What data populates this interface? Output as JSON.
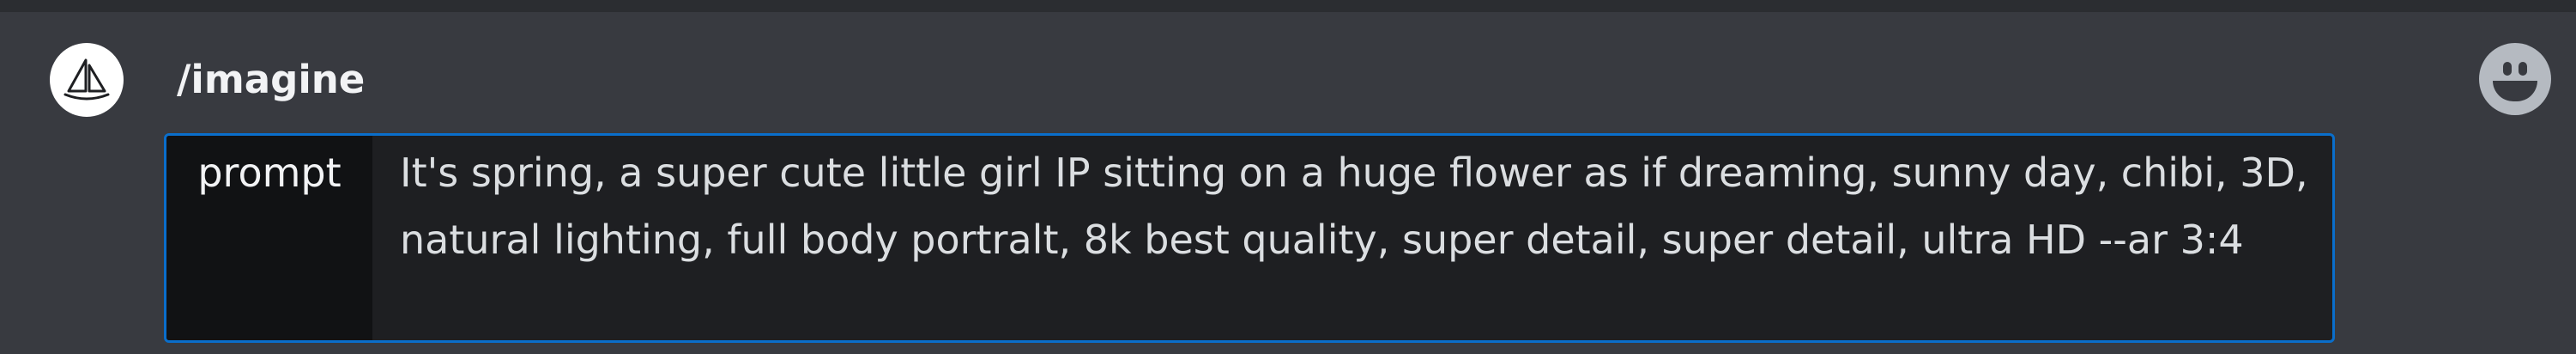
{
  "header": {
    "command": "/imagine"
  },
  "bot": {
    "avatar_icon": "sailboat-icon"
  },
  "emoji_button": {
    "icon": "smiley-face-icon"
  },
  "prompt": {
    "option_label": "prompt",
    "value": "It's spring, a super cute little girl IP sitting on a huge flower as if dreaming, sunny day, chibi, 3D, natural lighting, full body portralt, 8k best quality, super detail, super detail, ultra HD --ar 3:4"
  },
  "colors": {
    "focus_border": "#0a6ecb",
    "background": "#383a40",
    "input_background": "#1e1f22"
  }
}
